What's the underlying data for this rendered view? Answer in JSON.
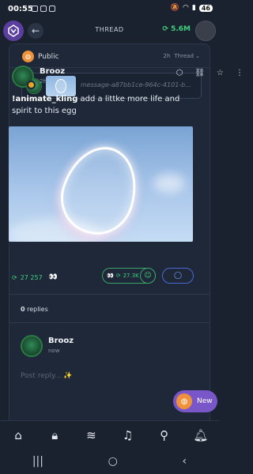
{
  "status_bar": {
    "time": "00:55",
    "battery": "46"
  },
  "header": {
    "title": "THREAD",
    "balance": "5.6M"
  },
  "thread": {
    "visibility": "Public",
    "age": "2h",
    "type_menu": "Thread",
    "quote_text": "message-a87bb1ce-964c-4101-b…"
  },
  "post": {
    "author": "Brooz",
    "time": "2h",
    "command": "!animate_kling",
    "text": " add a littke more life and spirit to this egg",
    "tip_count": "27 257",
    "reaction_count": "27.3K"
  },
  "replies": {
    "count": "0",
    "label": "replies"
  },
  "composer": {
    "author": "Brooz",
    "time": "now",
    "placeholder": "Post reply... ✨"
  },
  "fab": {
    "label": "New"
  },
  "colors": {
    "accent_green": "#3fd07c",
    "accent_purple": "#7a57c9",
    "accent_orange": "#f0923a"
  },
  "icons": {
    "tabs": [
      "home-icon",
      "lock-icon",
      "waves-icon",
      "voice-icon",
      "search-icon",
      "bell-icon"
    ],
    "post_actions": [
      "cube-icon",
      "link-icon",
      "star-icon",
      "more-icon"
    ]
  }
}
